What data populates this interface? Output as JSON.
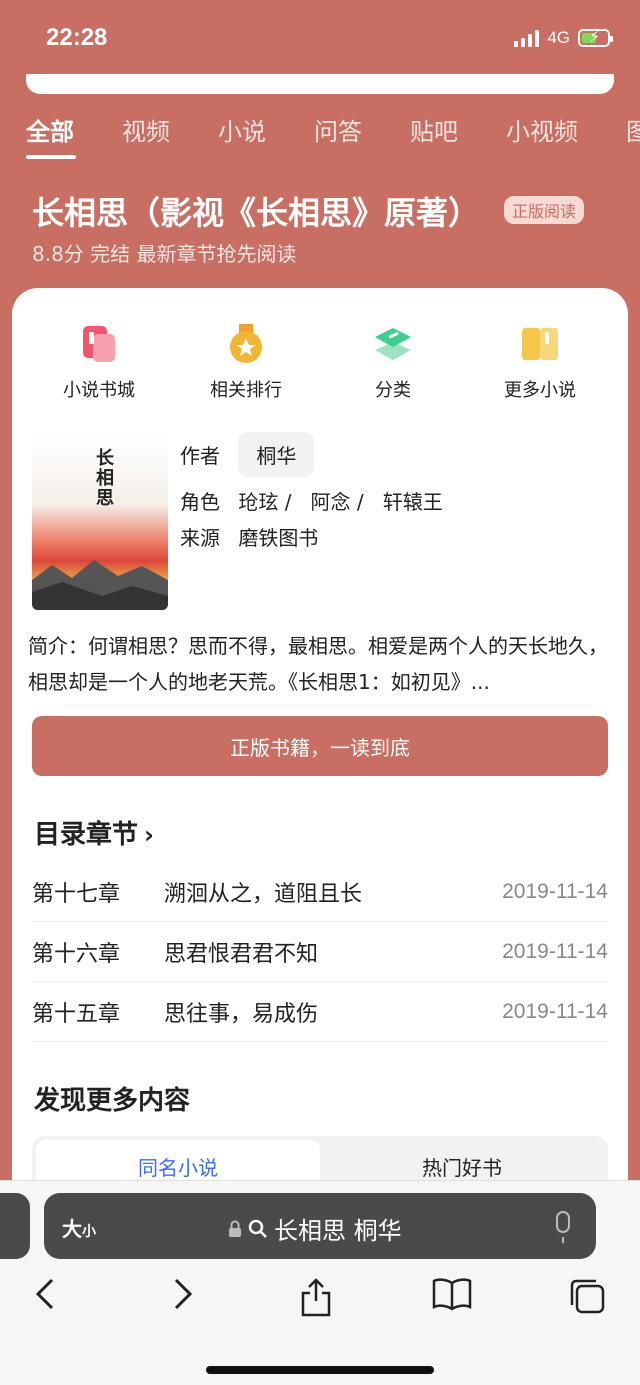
{
  "status": {
    "time": "22:28",
    "network": "4G"
  },
  "tabs": [
    "全部",
    "视频",
    "小说",
    "问答",
    "贴吧",
    "小视频",
    "图"
  ],
  "header": {
    "title": "长相思（影视《长相思》原著）",
    "badge": "正版阅读",
    "subline": "8.8分 完结 最新章节抢先阅读"
  },
  "quick_links": [
    {
      "label": "小说书城",
      "icon": "bookstore-icon",
      "color": "#f0566e"
    },
    {
      "label": "相关排行",
      "icon": "ranking-medal-icon",
      "color": "#f2b534"
    },
    {
      "label": "分类",
      "icon": "category-layers-icon",
      "color": "#3ccf8e"
    },
    {
      "label": "更多小说",
      "icon": "open-book-icon",
      "color": "#f6c64a"
    }
  ],
  "book": {
    "cover_title": "长相思",
    "author_key": "作者",
    "author": "桐华",
    "roles_key": "角色",
    "roles": [
      "玱玹 /",
      "阿念 /",
      "轩辕王"
    ],
    "source_key": "来源",
    "source": "磨铁图书",
    "intro": "简介：何谓相思？思而不得，最相思。相爱是两个人的天长地久，相思却是一个人的地老天荒。《长相思1：如初见》...",
    "read_button": "正版书籍，一读到底"
  },
  "chapters_section": {
    "title": "目录章节",
    "items": [
      {
        "num": "第十七章",
        "name": "溯洄从之，道阻且长",
        "date": "2019-11-14"
      },
      {
        "num": "第十六章",
        "name": "思君恨君君不知",
        "date": "2019-11-14"
      },
      {
        "num": "第十五章",
        "name": "思往事，易成伤",
        "date": "2019-11-14"
      }
    ]
  },
  "discover": {
    "title": "发现更多内容",
    "tabs": [
      "同名小说",
      "热门好书"
    ]
  },
  "toolbar": {
    "aa_big": "大",
    "aa_small": "小",
    "url": "长相思 桐华"
  },
  "colors": {
    "accent": "#c96e62",
    "link": "#3a6df0"
  }
}
